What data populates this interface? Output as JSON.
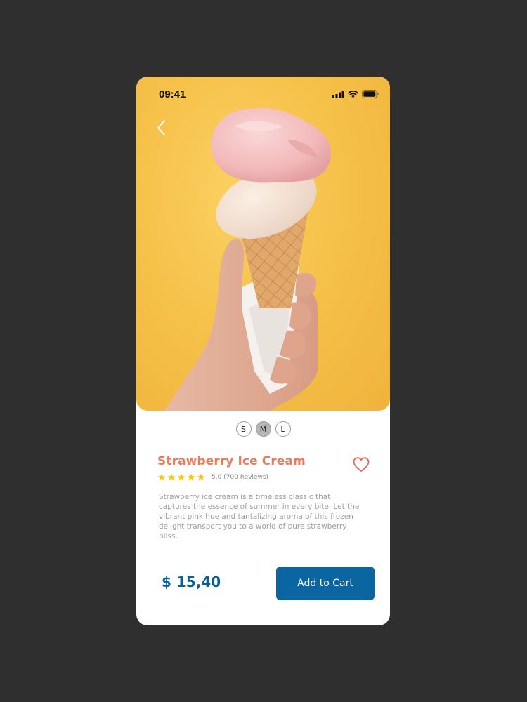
{
  "status_bar": {
    "time": "09:41",
    "icons": [
      "signal-icon",
      "wifi-icon",
      "battery-icon"
    ]
  },
  "navigation": {
    "back_icon": "chevron-left-icon"
  },
  "product": {
    "image": "ice-cream-cone-photo",
    "sizes": [
      {
        "label": "S",
        "selected": false
      },
      {
        "label": "M",
        "selected": true
      },
      {
        "label": "L",
        "selected": false
      }
    ],
    "name": "Strawberry Ice Cream",
    "favorite_icon": "heart-outline-icon",
    "rating": {
      "stars": 5,
      "max": 5,
      "text": "5.0 (700 Reviews)"
    },
    "description": "Strawberry ice cream is a timeless classic that captures the essence of summer in every bite. Let the vibrant pink hue and tantalizing aroma of this frozen delight transport you to a world of pure strawberry bliss.",
    "price": "$ 15,40"
  },
  "actions": {
    "add_to_cart_label": "Add to Cart"
  },
  "colors": {
    "background": "#2f2f2f",
    "hero_background": "#f6c24a",
    "title": "#e87d5e",
    "accent_blue": "#0b65a0",
    "star": "#f5c518"
  }
}
